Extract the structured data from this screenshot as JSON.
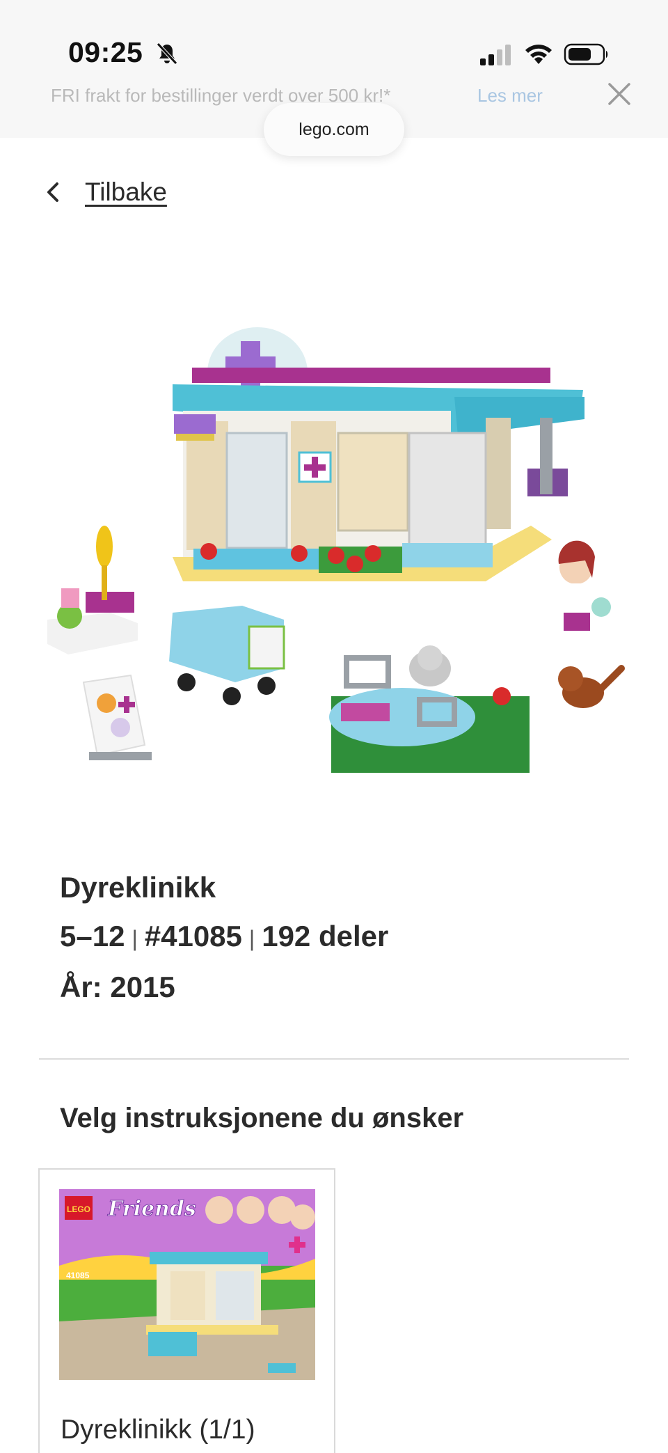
{
  "status_bar": {
    "time": "09:25",
    "icons": [
      "bell-slash-icon",
      "cellular-signal-icon",
      "wifi-icon",
      "battery-icon"
    ]
  },
  "promo": {
    "text": "FRI frakt for bestillinger verdt over 500 kr!*",
    "link": "Les mer",
    "close_icon": "close-icon"
  },
  "browser": {
    "url": "lego.com"
  },
  "back": {
    "label": "Tilbake",
    "icon": "chevron-left-icon"
  },
  "product": {
    "name": "Dyreklinikk",
    "age": "5–12",
    "set_number": "#41085",
    "pieces": "192 deler",
    "year": "År: 2015"
  },
  "instructions": {
    "title": "Velg instruksjonene du ønsker",
    "items": [
      {
        "label": "Dyreklinikk (1/1)",
        "cover_brand": "LEGO",
        "cover_theme": "Friends",
        "cover_number": "41085"
      }
    ]
  },
  "colors": {
    "promo_link": "#a9c6e2",
    "text": "#2b2b2b",
    "banner_bg": "#f7f7f7"
  }
}
